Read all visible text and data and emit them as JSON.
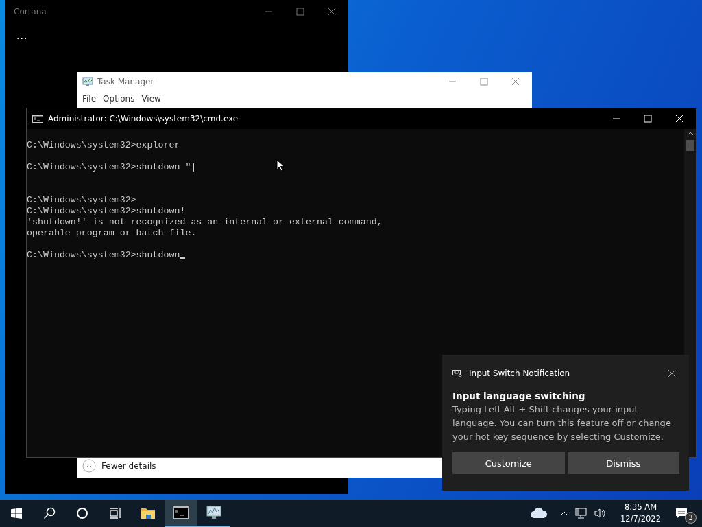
{
  "cortana_window": {
    "title": "Cortana",
    "status": "..."
  },
  "task_manager": {
    "title": "Task Manager",
    "menu": [
      "File",
      "Options",
      "View"
    ],
    "footer_link": "Fewer details"
  },
  "cmd_window": {
    "title": "Administrator: C:\\Windows\\system32\\cmd.exe",
    "cursor_visible": true,
    "lines": [
      {
        "kind": "line",
        "text": "C:\\Windows\\system32>explorer"
      },
      {
        "kind": "after_blank",
        "text": "C:\\Windows\\system32>shutdown \"|"
      },
      {
        "kind": "after_two_blanks",
        "text": "C:\\Windows\\system32>"
      },
      {
        "kind": "line",
        "text": "C:\\Windows\\system32>shutdown!"
      },
      {
        "kind": "line",
        "text": "'shutdown!' is not recognized as an internal or external command,"
      },
      {
        "kind": "line",
        "text": "operable program or batch file."
      },
      {
        "kind": "after_blank",
        "text": "C:\\Windows\\system32>shutdown"
      }
    ]
  },
  "notification": {
    "app": "Input Switch Notification",
    "title": "Input language switching",
    "body": "Typing Left Alt + Shift changes your input language. You can turn this feature off or change your hot key sequence by selecting Customize.",
    "buttons": [
      "Customize",
      "Dismiss"
    ]
  },
  "taskbar": {
    "items": [
      {
        "kind": "start",
        "running": false,
        "selected": false
      },
      {
        "kind": "search",
        "running": false,
        "selected": false
      },
      {
        "kind": "cortana",
        "running": false,
        "selected": false
      },
      {
        "kind": "task_view",
        "running": false,
        "selected": false
      },
      {
        "kind": "explorer",
        "running": false,
        "selected": false
      },
      {
        "kind": "cmd",
        "running": true,
        "selected": true
      },
      {
        "kind": "task_manager",
        "running": true,
        "selected": false
      }
    ],
    "time": "8:35 AM",
    "date": "12/7/2022",
    "notification_count": "3"
  }
}
